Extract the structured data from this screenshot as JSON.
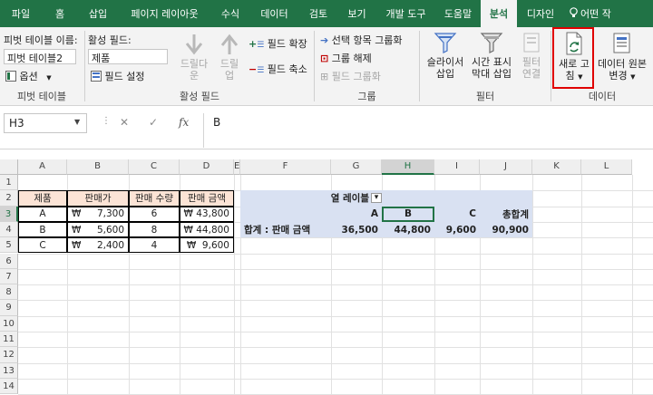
{
  "tabs": [
    "파일",
    "홈",
    "삽입",
    "페이지 레이아웃",
    "수식",
    "데이터",
    "검토",
    "보기",
    "개발 도구",
    "도움말",
    "분석",
    "디자인",
    "어떤 작"
  ],
  "ribbon": {
    "pivot_name_label": "피벗 테이블 이름:",
    "pivot_name_value": "피벗 테이블2",
    "options_label": "옵션",
    "group_pivot": "피벗 테이블",
    "active_field_label": "활성 필드:",
    "active_field_value": "제품",
    "field_settings": "필드 설정",
    "drilldown": "드릴다운",
    "drillup_1": "드릴",
    "drillup_2": "업",
    "expand_field": "필드 확장",
    "collapse_field": "필드 축소",
    "group_active": "활성 필드",
    "group_selection": "선택 항목 그룹화",
    "ungroup": "그룹 해제",
    "group_field": "필드 그룹화",
    "group_group": "그룹",
    "slicer_1": "슬라이서",
    "slicer_2": "삽입",
    "timeline_1": "시간 표시",
    "timeline_2": "막대 삽입",
    "filter_conn_1": "필터",
    "filter_conn_2": "연결",
    "group_filter": "필터",
    "refresh_1": "새로 고",
    "refresh_2": "침",
    "change_source_1": "데이터 원본",
    "change_source_2": "변경",
    "group_data": "데이터"
  },
  "formula": {
    "cell_ref": "H3",
    "content": "B"
  },
  "columns": [
    "A",
    "B",
    "C",
    "D",
    "E",
    "F",
    "G",
    "H",
    "I",
    "J",
    "K",
    "L"
  ],
  "rows": [
    "1",
    "2",
    "3",
    "4",
    "5",
    "6",
    "7",
    "8",
    "9",
    "10",
    "11",
    "12",
    "13",
    "14"
  ],
  "source_table": {
    "headers": [
      "제품",
      "판매가",
      "판매 수량",
      "판매 금액"
    ],
    "rows": [
      {
        "product": "A",
        "price_sym": "₩",
        "price": "7,300",
        "qty": "6",
        "amount": "₩ 43,800"
      },
      {
        "product": "B",
        "price_sym": "₩",
        "price": "5,600",
        "qty": "8",
        "amount": "₩ 44,800"
      },
      {
        "product": "C",
        "price_sym": "₩",
        "price": "2,400",
        "qty": "4",
        "amount": "₩  9,600"
      }
    ]
  },
  "pivot": {
    "col_label": "열 레이블",
    "categories": [
      "A",
      "B",
      "C",
      "총합계"
    ],
    "row_label": "합계 : 판매 금액",
    "values": [
      "36,500",
      "44,800",
      "9,600",
      "90,900"
    ]
  },
  "colors": {
    "accent": "#217346",
    "header_fill": "#fce4d6",
    "pivot_fill": "#d9e1f2",
    "highlight": "#e00000"
  }
}
